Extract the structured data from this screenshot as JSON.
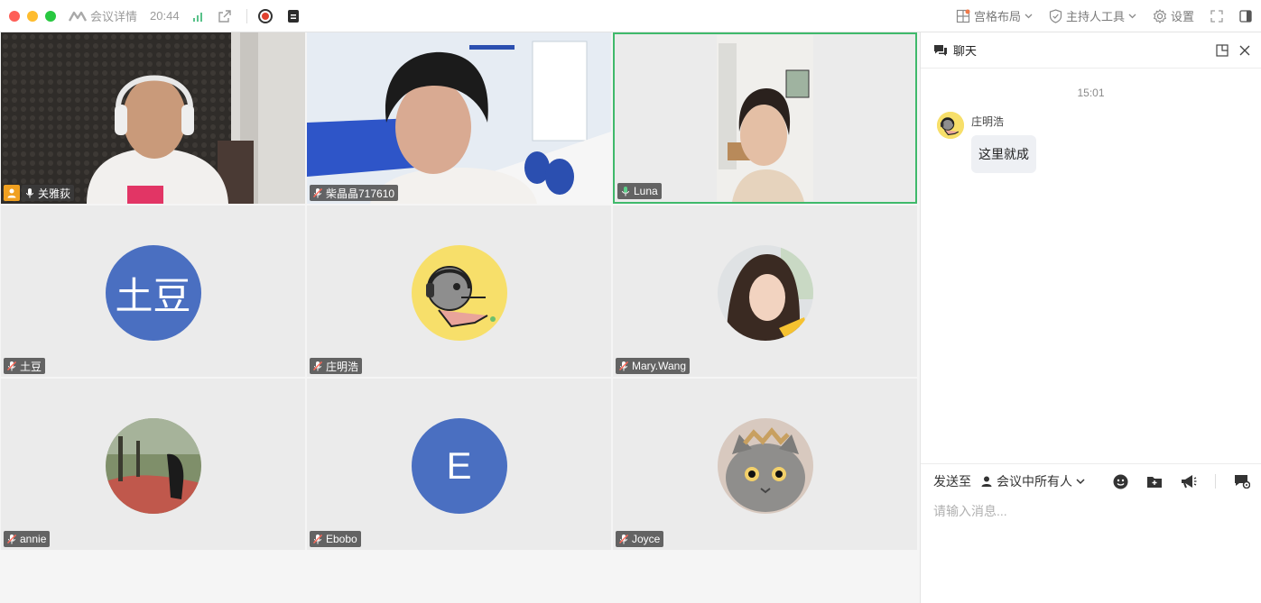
{
  "titlebar": {
    "meeting_details": "会议详情",
    "elapsed": "20:44",
    "layout": "宫格布局",
    "host_tools": "主持人工具",
    "settings": "设置"
  },
  "participants": [
    {
      "name": "关雅荻",
      "type": "video",
      "host": true
    },
    {
      "name": "柴晶晶717610",
      "type": "video"
    },
    {
      "name": "Luna",
      "type": "video",
      "speaking": true
    },
    {
      "name": "土豆",
      "type": "text-avatar",
      "avatar_text": "土豆"
    },
    {
      "name": "庄明浩",
      "type": "image-avatar"
    },
    {
      "name": "Mary.Wang",
      "type": "image-avatar"
    },
    {
      "name": "annie",
      "type": "image-avatar"
    },
    {
      "name": "Ebobo",
      "type": "text-avatar",
      "avatar_text": "E"
    },
    {
      "name": "Joyce",
      "type": "image-avatar"
    }
  ],
  "chat": {
    "title": "聊天",
    "time": "15:01",
    "messages": [
      {
        "sender": "庄明浩",
        "text": "这里就成"
      }
    ],
    "send_to_label": "发送至",
    "send_to_target": "会议中所有人",
    "input_placeholder": "请输入消息..."
  },
  "colors": {
    "active_border": "#3fb96b",
    "avatar_blue": "#4a6fc1",
    "record_red": "#e0412e"
  }
}
